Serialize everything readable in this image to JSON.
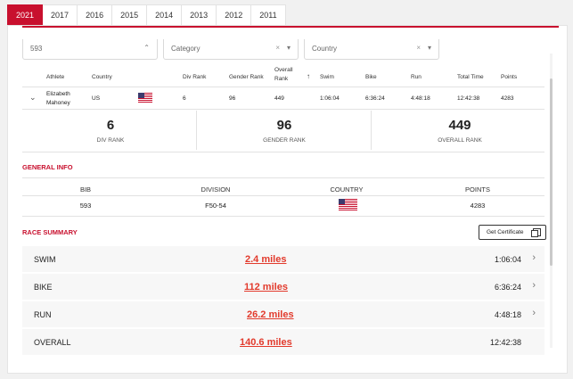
{
  "tabs": [
    "2021",
    "2017",
    "2016",
    "2015",
    "2014",
    "2013",
    "2012",
    "2011"
  ],
  "filters": {
    "bib": "593",
    "category": "Category",
    "country": "Country"
  },
  "table": {
    "headers": {
      "athlete": "Athlete",
      "country": "Country",
      "div_rank": "Div Rank",
      "gender_rank": "Gender Rank",
      "overall_rank": "Overall Rank",
      "swim": "Swim",
      "bike": "Bike",
      "run": "Run",
      "total_time": "Total Time",
      "points": "Points"
    },
    "row": {
      "athlete": "Elizabeth Mahoney",
      "country": "US",
      "div_rank": "6",
      "gender_rank": "96",
      "overall_rank": "449",
      "swim": "1:06:04",
      "bike": "6:36:24",
      "run": "4:48:18",
      "total_time": "12:42:38",
      "points": "4283"
    }
  },
  "ranks": [
    {
      "value": "6",
      "label": "DIV RANK"
    },
    {
      "value": "96",
      "label": "GENDER RANK"
    },
    {
      "value": "449",
      "label": "OVERALL RANK"
    }
  ],
  "general_info": {
    "title": "GENERAL INFO",
    "headers": {
      "bib": "BIB",
      "division": "DIVISION",
      "country": "COUNTRY",
      "points": "POINTS"
    },
    "values": {
      "bib": "593",
      "division": "F50-54",
      "points": "4283"
    }
  },
  "race_summary": {
    "title": "RACE SUMMARY",
    "cert_label": "Get Certificate",
    "rows": [
      {
        "name": "SWIM",
        "distance": "2.4 miles",
        "time": "1:06:04"
      },
      {
        "name": "BIKE",
        "distance": "112 miles",
        "time": "6:36:24"
      },
      {
        "name": "RUN",
        "distance": "26.2 miles",
        "time": "4:48:18"
      },
      {
        "name": "OVERALL",
        "distance": "140.6 miles",
        "time": "12:42:38"
      }
    ]
  },
  "colors": {
    "accent": "#c8102e",
    "distance": "#e23a2c"
  }
}
